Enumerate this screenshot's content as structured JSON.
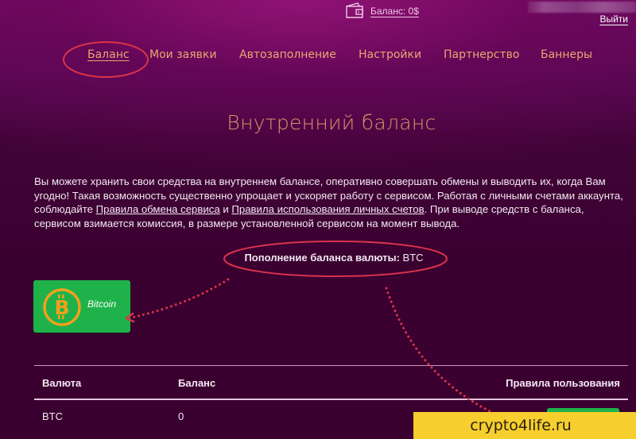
{
  "header": {
    "wallet_icon": "wallet-icon",
    "balance_link": "Баланс: 0$",
    "logout": "Выйти"
  },
  "nav": {
    "items": [
      {
        "label": "Баланс",
        "active": true
      },
      {
        "label": "Мои заявки"
      },
      {
        "label": "Автозаполнение"
      },
      {
        "label": "Настройки"
      },
      {
        "label": "Партнерство"
      },
      {
        "label": "Баннеры"
      }
    ]
  },
  "page": {
    "title": "Внутренний баланс",
    "description": {
      "part1": "Вы можете хранить свои средства на внутреннем балансе, оперативно совершать обмены и выводить их, когда Вам угодно! Такая возможность существенно упрощает и ускоряет работу с сервисом. Работая с личными счетами аккаунта, соблюдайте ",
      "link1": "Правила обмена сервиса",
      "part2": " и ",
      "link2": "Правила использования личных счетов",
      "part3": ". При выводе средств с баланса, сервисом взимается комиссия, в размере установленной сервисом на момент вывода."
    },
    "topup_label": "Пополнение баланса валюты:",
    "topup_currency": " BTC",
    "currency_card": {
      "icon": "bitcoin-icon",
      "name": "Bitcoin"
    }
  },
  "table": {
    "headers": [
      "Валюта",
      "Баланс",
      "Правила пользования"
    ],
    "rows": [
      {
        "currency": "BTC",
        "balance": "0"
      }
    ]
  },
  "annotations": {
    "highlight_color": "#d9334a",
    "watermark": "crypto4life.ru"
  },
  "colors": {
    "accent_orange": "#e8a870",
    "button_green": "#1fb24a",
    "bitcoin_orange": "#f2a01c",
    "watermark_yellow": "#f6cf2e"
  }
}
